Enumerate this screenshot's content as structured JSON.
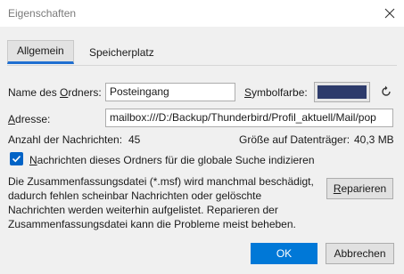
{
  "window": {
    "title": "Eigenschaften",
    "close_icon": "close-icon"
  },
  "tabs": [
    {
      "label": "Allgemein",
      "active": true
    },
    {
      "label": "Speicherplatz",
      "active": false
    }
  ],
  "form": {
    "folder_name_label_pre": "Name des ",
    "folder_name_label_u": "O",
    "folder_name_label_post": "rdners:",
    "folder_name_value": "Posteingang",
    "color_label_pre": "",
    "color_label_u": "S",
    "color_label_post": "ymbolfarbe:",
    "color_value": "#2d3b6b",
    "address_label_u": "A",
    "address_label_post": "dresse:",
    "address_value": "mailbox:///D:/Backup/Thunderbird/Profil_aktuell/Mail/pop",
    "message_count_label": "Anzahl der Nachrichten:",
    "message_count_value": "45",
    "disk_size_label": "Größe auf Datenträger:",
    "disk_size_value": "40,3 MB"
  },
  "checkbox": {
    "checked": true,
    "label_u": "N",
    "label_post": "achrichten dieses Ordners für die globale Suche indizieren"
  },
  "description": "Die Zusammenfassungsdatei (*.msf) wird manchmal beschädigt, dadurch fehlen scheinbar Nachrichten oder gelöschte Nachrichten werden weiterhin aufgelistet. Reparieren der Zusammenfassungsdatei kann die Probleme meist beheben.",
  "buttons": {
    "repair_u": "R",
    "repair_post": "eparieren",
    "ok": "OK",
    "cancel": "Abbrechen"
  },
  "colors": {
    "accent": "#0078d7",
    "checkbox": "#0063c6",
    "tab_underline": "#1f6fd1"
  }
}
